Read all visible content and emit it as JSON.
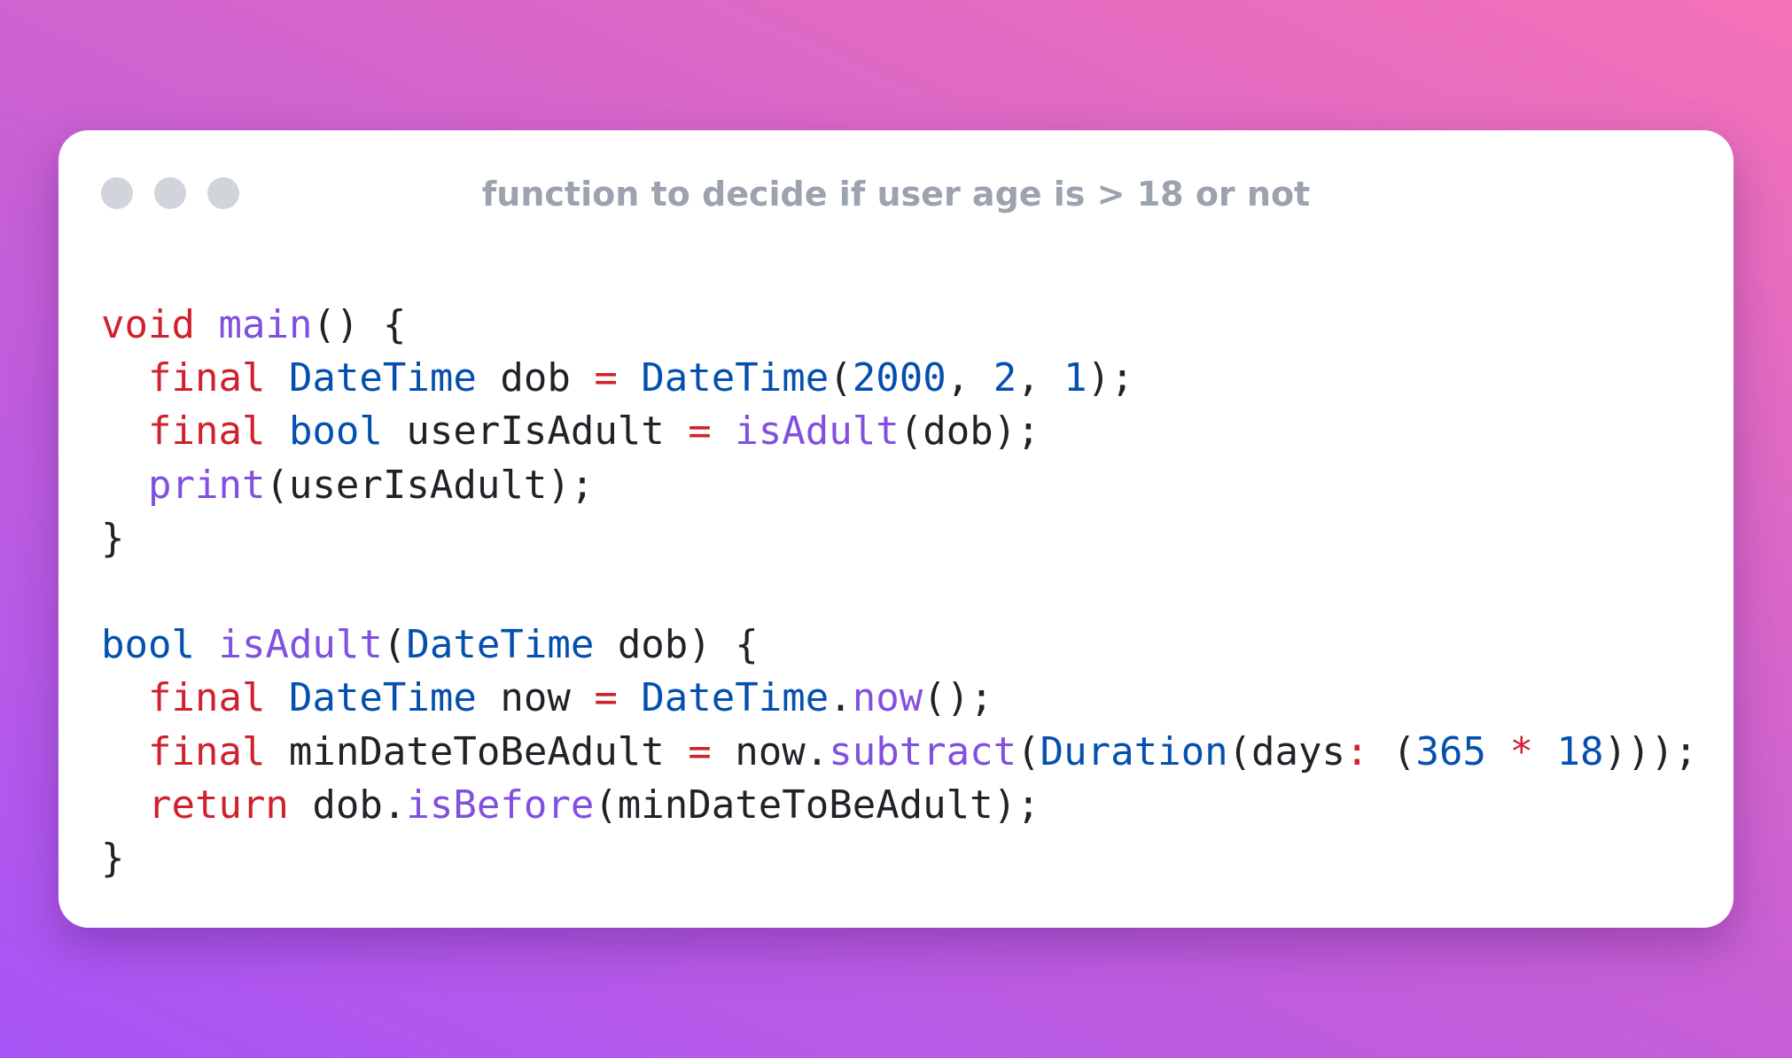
{
  "window": {
    "title": "function to decide if user age is > 18 or not",
    "controls": [
      "close-dot",
      "minimize-dot",
      "maximize-dot"
    ]
  },
  "code": {
    "language": "dart",
    "lines": [
      [
        {
          "t": "kw",
          "v": "void"
        },
        {
          "t": "pl",
          "v": " "
        },
        {
          "t": "fn",
          "v": "main"
        },
        {
          "t": "pl",
          "v": "() {"
        }
      ],
      [
        {
          "t": "pl",
          "v": "  "
        },
        {
          "t": "kw",
          "v": "final"
        },
        {
          "t": "pl",
          "v": " "
        },
        {
          "t": "ty",
          "v": "DateTime"
        },
        {
          "t": "pl",
          "v": " dob "
        },
        {
          "t": "op",
          "v": "="
        },
        {
          "t": "pl",
          "v": " "
        },
        {
          "t": "ty",
          "v": "DateTime"
        },
        {
          "t": "pl",
          "v": "("
        },
        {
          "t": "num",
          "v": "2000"
        },
        {
          "t": "pl",
          "v": ", "
        },
        {
          "t": "num",
          "v": "2"
        },
        {
          "t": "pl",
          "v": ", "
        },
        {
          "t": "num",
          "v": "1"
        },
        {
          "t": "pl",
          "v": ");"
        }
      ],
      [
        {
          "t": "pl",
          "v": "  "
        },
        {
          "t": "kw",
          "v": "final"
        },
        {
          "t": "pl",
          "v": " "
        },
        {
          "t": "ty",
          "v": "bool"
        },
        {
          "t": "pl",
          "v": " userIsAdult "
        },
        {
          "t": "op",
          "v": "="
        },
        {
          "t": "pl",
          "v": " "
        },
        {
          "t": "fn",
          "v": "isAdult"
        },
        {
          "t": "pl",
          "v": "(dob);"
        }
      ],
      [
        {
          "t": "pl",
          "v": "  "
        },
        {
          "t": "fn",
          "v": "print"
        },
        {
          "t": "pl",
          "v": "(userIsAdult);"
        }
      ],
      [
        {
          "t": "pl",
          "v": "}"
        }
      ],
      [
        {
          "t": "pl",
          "v": ""
        }
      ],
      [
        {
          "t": "ty",
          "v": "bool"
        },
        {
          "t": "pl",
          "v": " "
        },
        {
          "t": "fn",
          "v": "isAdult"
        },
        {
          "t": "pl",
          "v": "("
        },
        {
          "t": "ty",
          "v": "DateTime"
        },
        {
          "t": "pl",
          "v": " dob) {"
        }
      ],
      [
        {
          "t": "pl",
          "v": "  "
        },
        {
          "t": "kw",
          "v": "final"
        },
        {
          "t": "pl",
          "v": " "
        },
        {
          "t": "ty",
          "v": "DateTime"
        },
        {
          "t": "pl",
          "v": " now "
        },
        {
          "t": "op",
          "v": "="
        },
        {
          "t": "pl",
          "v": " "
        },
        {
          "t": "ty",
          "v": "DateTime"
        },
        {
          "t": "pl",
          "v": "."
        },
        {
          "t": "fn",
          "v": "now"
        },
        {
          "t": "pl",
          "v": "();"
        }
      ],
      [
        {
          "t": "pl",
          "v": "  "
        },
        {
          "t": "kw",
          "v": "final"
        },
        {
          "t": "pl",
          "v": " minDateToBeAdult "
        },
        {
          "t": "op",
          "v": "="
        },
        {
          "t": "pl",
          "v": " now."
        },
        {
          "t": "fn",
          "v": "subtract"
        },
        {
          "t": "pl",
          "v": "("
        },
        {
          "t": "ty",
          "v": "Duration"
        },
        {
          "t": "pl",
          "v": "(days"
        },
        {
          "t": "op",
          "v": ":"
        },
        {
          "t": "pl",
          "v": " ("
        },
        {
          "t": "num",
          "v": "365"
        },
        {
          "t": "pl",
          "v": " "
        },
        {
          "t": "op",
          "v": "*"
        },
        {
          "t": "pl",
          "v": " "
        },
        {
          "t": "num",
          "v": "18"
        },
        {
          "t": "pl",
          "v": ")));"
        }
      ],
      [
        {
          "t": "pl",
          "v": "  "
        },
        {
          "t": "kw",
          "v": "return"
        },
        {
          "t": "pl",
          "v": " dob."
        },
        {
          "t": "fn",
          "v": "isBefore"
        },
        {
          "t": "pl",
          "v": "(minDateToBeAdult);"
        }
      ],
      [
        {
          "t": "pl",
          "v": "}"
        }
      ]
    ]
  },
  "colors": {
    "keyword": "#cf222e",
    "function": "#8250df",
    "type": "#0550ae",
    "number": "#0550ae",
    "plain": "#1f2328",
    "title": "#9ca3af",
    "dot": "#d1d5db",
    "card": "#ffffff",
    "gradient_start": "#a855f7",
    "gradient_end": "#f472b6"
  }
}
